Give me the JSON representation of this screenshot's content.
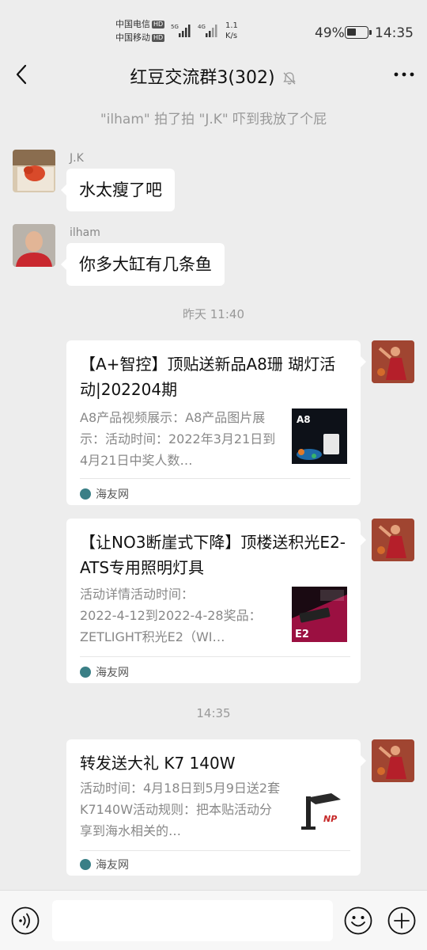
{
  "status": {
    "carrier1": "中国电信",
    "carrier2": "中国移动",
    "hd": "HD",
    "net1": "5G",
    "net2": "4G",
    "speed_value": "1.1",
    "speed_unit": "K/s",
    "battery_pct": "49%",
    "battery_level": 0.49,
    "time": "14:35"
  },
  "header": {
    "title": "红豆交流群3(302)"
  },
  "system_message": "\"ilham\" 拍了拍 \"J.K\" 吓到我放了个屁",
  "messages": [
    {
      "sender": "J.K",
      "text": "水太瘦了吧"
    },
    {
      "sender": "ilham",
      "text": "你多大缸有几条鱼"
    }
  ],
  "timestamps": [
    "昨天 11:40",
    "14:35"
  ],
  "cards": [
    {
      "title": "【A+智控】顶贴送新品A8珊 瑚灯活动|202204期",
      "description": "A8产品视频展示：A8产品图片展示：活动时间：2022年3月21日到4月21日中奖人数…",
      "thumb_label": "A8",
      "source": "海友网"
    },
    {
      "title": "【让NO3断崖式下降】顶楼送积光E2-ATS专用照明灯具",
      "description": "活动详情活动时间：\n2022-4-12到2022-4-28奖品：ZETLIGHT积光E2（WI…",
      "thumb_label": "E2",
      "source": "海友网"
    },
    {
      "title": "转发送大礼 K7 140W",
      "description": "活动时间：4月18日到5月9日送2套K7140W活动规则：把本贴活动分享到海水相关的…",
      "thumb_label": "",
      "source": "海友网"
    }
  ],
  "input": {
    "placeholder": ""
  }
}
